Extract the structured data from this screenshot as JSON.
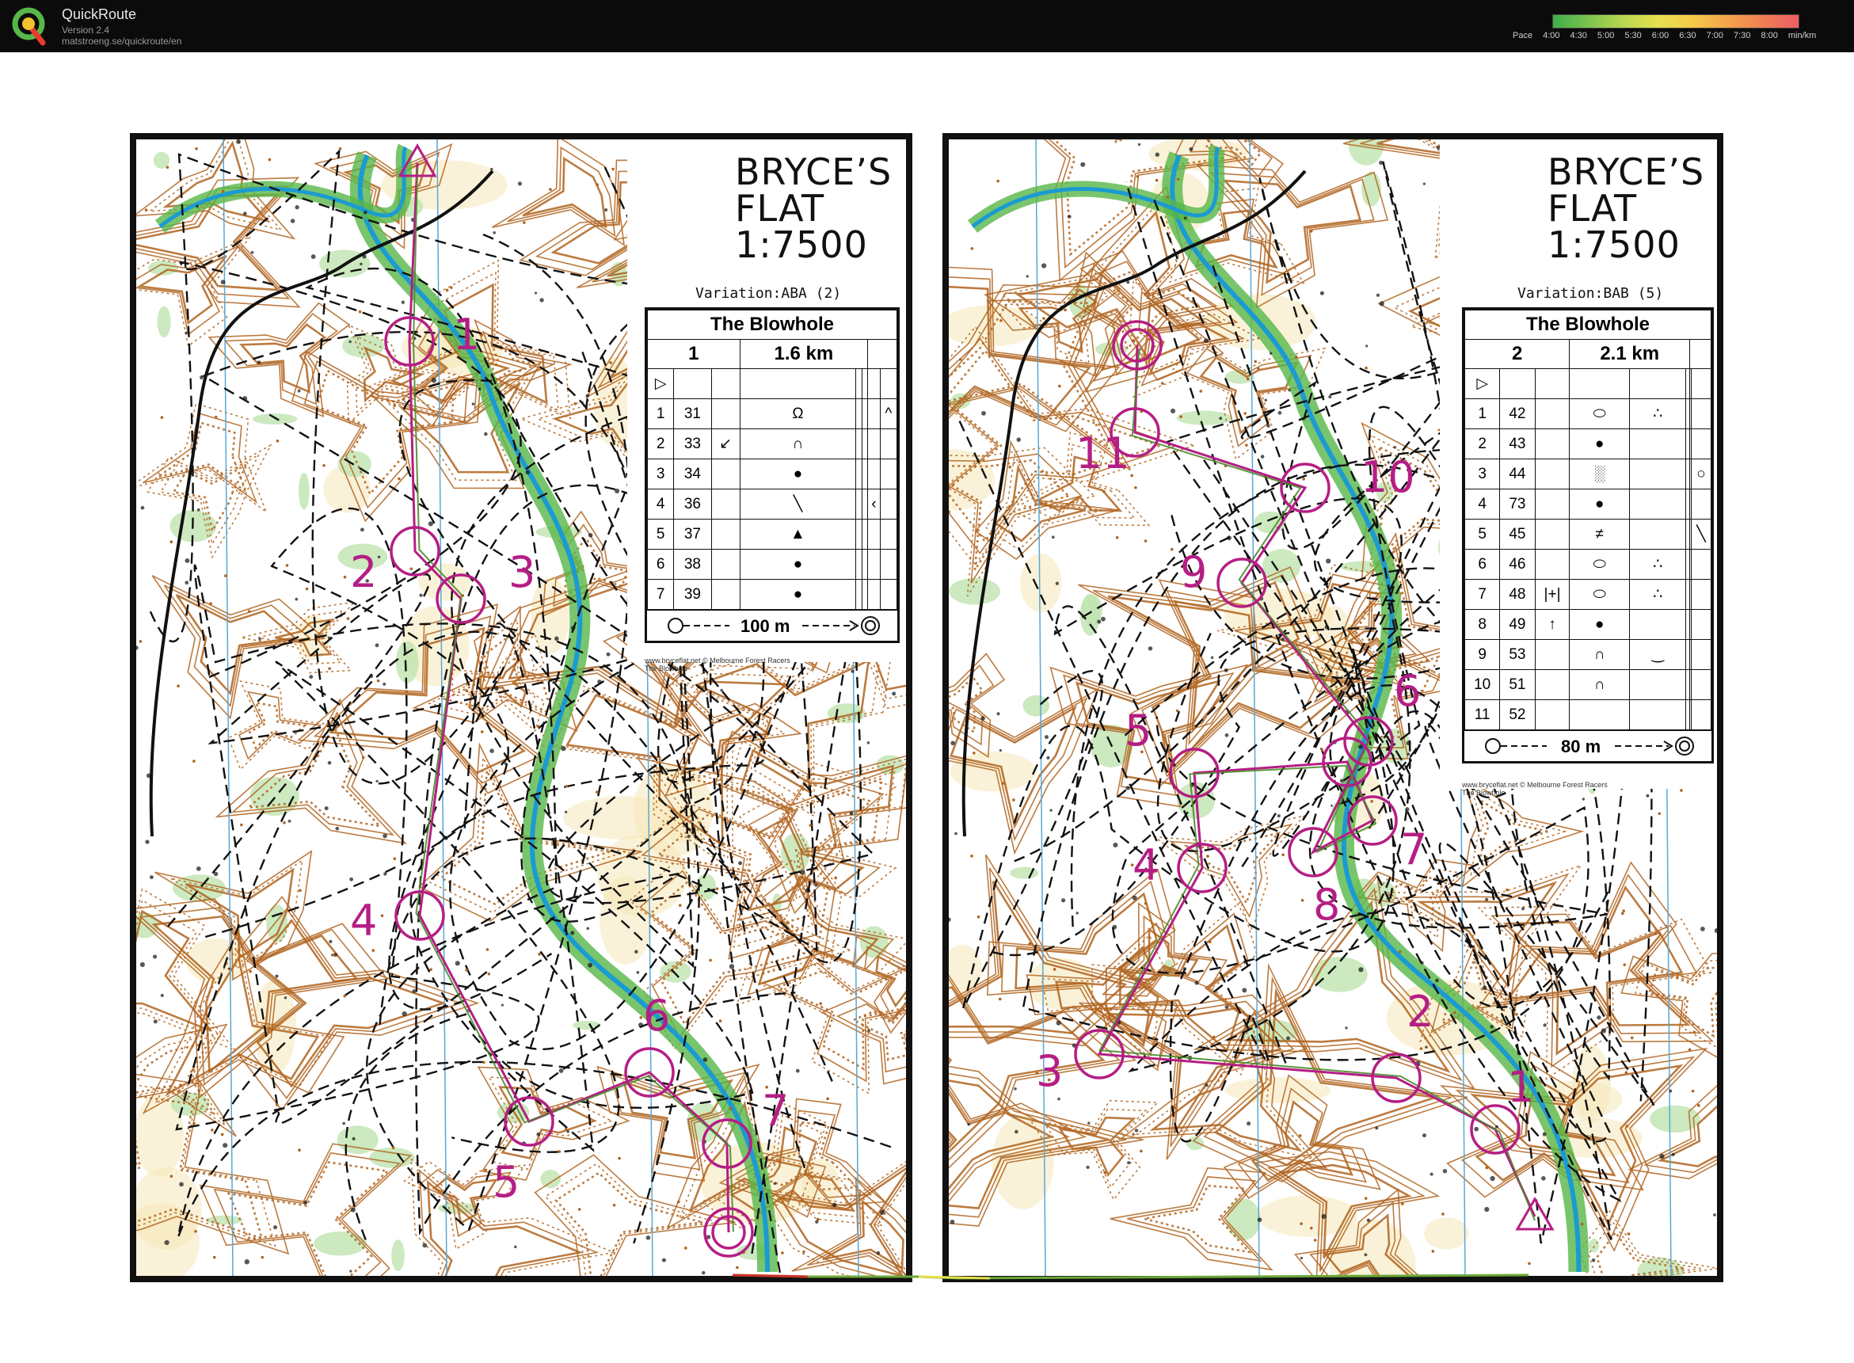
{
  "app": {
    "name": "QuickRoute",
    "version": "Version 2.4",
    "url": "matstroeng.se/quickroute/en"
  },
  "pace_legend": {
    "label": "Pace",
    "ticks": [
      "4:00",
      "4:30",
      "5:00",
      "5:30",
      "6:00",
      "6:30",
      "7:00",
      "7:30",
      "8:00"
    ],
    "unit": "min/km",
    "colors": [
      "#3fae49",
      "#7cc24f",
      "#b9d651",
      "#e5e04f",
      "#f4c94a",
      "#f3a24a",
      "#f07e55",
      "#ee5d65"
    ]
  },
  "colors": {
    "course": "#b51e84",
    "contour": "#b0641e",
    "water": "#1b9bd1",
    "vegetation": "#57b749"
  },
  "maps": [
    {
      "id": "left",
      "title_lines": [
        "BRYCE’S",
        "FLAT",
        "1:7500"
      ],
      "variation": "Variation:ABA (2)",
      "event": "The Blowhole",
      "course": "1",
      "length": "1.6 km",
      "start_symbol": "▷",
      "controls": [
        {
          "n": "1",
          "code": "31",
          "c": "",
          "d": "Ω",
          "g": "",
          "h": "^"
        },
        {
          "n": "2",
          "code": "33",
          "c": "↙",
          "d": "∩",
          "g": "",
          "h": ""
        },
        {
          "n": "3",
          "code": "34",
          "c": "",
          "d": "●",
          "g": "",
          "h": ""
        },
        {
          "n": "4",
          "code": "36",
          "c": "",
          "d": "╲",
          "g": "‹",
          "h": ""
        },
        {
          "n": "5",
          "code": "37",
          "c": "",
          "d": "▲",
          "g": "",
          "h": ""
        },
        {
          "n": "6",
          "code": "38",
          "c": "",
          "d": "●",
          "g": "",
          "h": ""
        },
        {
          "n": "7",
          "code": "39",
          "c": "",
          "d": "●",
          "g": "",
          "h": ""
        }
      ],
      "finish_text": "100 m",
      "credit": "www.bryceflat.net © Melbourne Forest Racers\nThe Blowhole",
      "control_labels": [
        "1",
        "2",
        "3",
        "4",
        "5",
        "6",
        "7"
      ]
    },
    {
      "id": "right",
      "title_lines": [
        "BRYCE’S",
        "FLAT",
        "1:7500"
      ],
      "variation": "Variation:BAB (5)",
      "event": "The Blowhole",
      "course": "2",
      "length": "2.1 km",
      "start_symbol": "▷",
      "controls": [
        {
          "n": "1",
          "code": "42",
          "c": "",
          "d": "⬭",
          "e": "∴",
          "h": ""
        },
        {
          "n": "2",
          "code": "43",
          "c": "",
          "d": "●",
          "e": "",
          "h": ""
        },
        {
          "n": "3",
          "code": "44",
          "c": "",
          "d": "░",
          "e": "",
          "h": "○"
        },
        {
          "n": "4",
          "code": "73",
          "c": "",
          "d": "●",
          "e": "",
          "h": ""
        },
        {
          "n": "5",
          "code": "45",
          "c": "",
          "d": "≠",
          "e": "",
          "h": "╲"
        },
        {
          "n": "6",
          "code": "46",
          "c": "",
          "d": "⬭",
          "e": "∴",
          "h": ""
        },
        {
          "n": "7",
          "code": "48",
          "c": "|+|",
          "d": "⬭",
          "e": "∴",
          "h": ""
        },
        {
          "n": "8",
          "code": "49",
          "c": "↑",
          "d": "●",
          "e": "",
          "h": ""
        },
        {
          "n": "9",
          "code": "53",
          "c": "",
          "d": "∩",
          "e": "‿",
          "h": ""
        },
        {
          "n": "10",
          "code": "51",
          "c": "",
          "d": "∩",
          "e": "",
          "h": ""
        },
        {
          "n": "11",
          "code": "52",
          "c": "",
          "d": "",
          "e": "",
          "h": ""
        }
      ],
      "finish_text": "80 m",
      "credit": "www.bryceflat.net © Melbourne Forest Racers\nThe Blowhole",
      "control_labels": [
        "1",
        "2",
        "3",
        "4",
        "5",
        "6",
        "7",
        "8",
        "9",
        "10",
        "11"
      ]
    }
  ]
}
